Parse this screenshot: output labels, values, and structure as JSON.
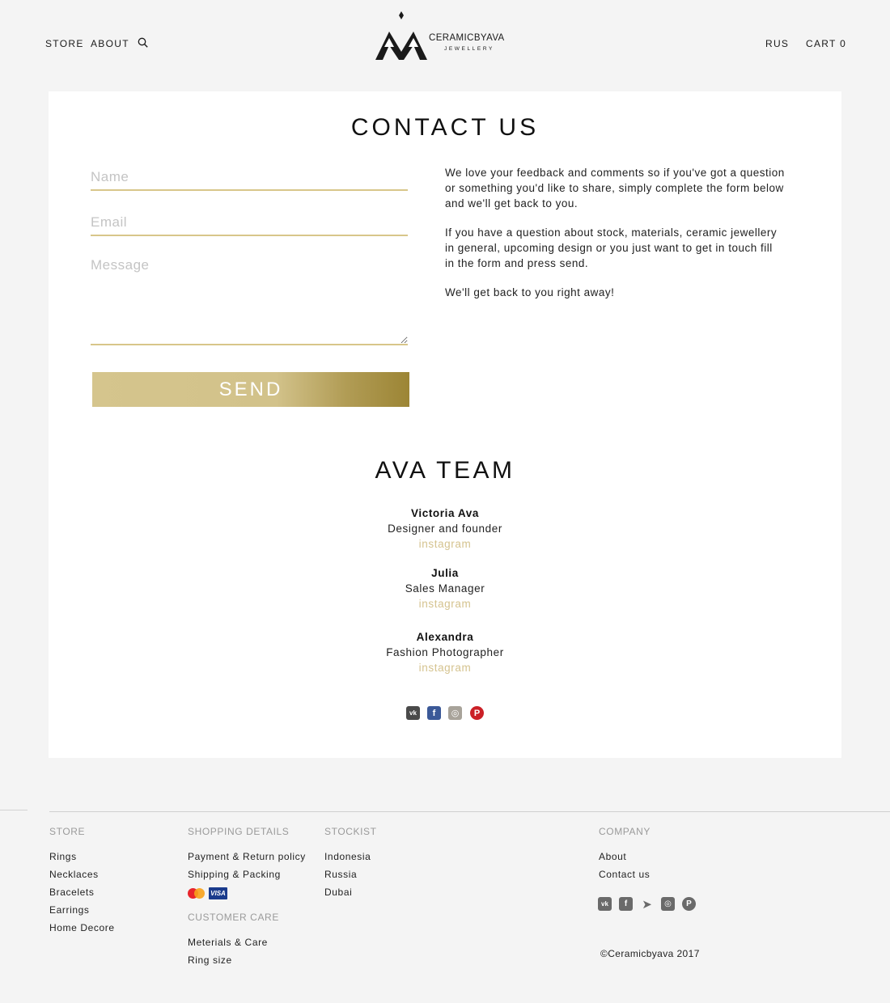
{
  "header": {
    "nav": [
      {
        "label": "STORE"
      },
      {
        "label": "ABOUT"
      }
    ],
    "logo": {
      "wordmark": "CERAMICBYAVA",
      "sub": "JEWELLERY"
    },
    "lang": "RUS",
    "cart": "CART 0"
  },
  "contact": {
    "title": "CONTACT US",
    "name_placeholder": "Name",
    "email_placeholder": "Email",
    "message_placeholder": "Message",
    "send_label": "SEND",
    "paragraphs": [
      "We love your feedback and comments so if you've got a question or something you'd like to share, simply complete the form below and we'll get back to you.",
      "If you have a question about stock, materials, ceramic jewellery in general, upcoming design or you just want to get in touch fill in the form and press send.",
      "We'll get back to you right away!"
    ]
  },
  "team": {
    "title": "AVA TEAM",
    "members": [
      {
        "name": "Victoria Ava",
        "role": "Designer and founder",
        "link": "instagram"
      },
      {
        "name": "Julia",
        "role": "Sales Manager",
        "link": "instagram"
      },
      {
        "name": "Alexandra",
        "role": "Fashion Photographer",
        "link": "instagram"
      }
    ],
    "social": [
      {
        "icon": "vk-icon",
        "glyph": "vk",
        "color": "#4a4a4a"
      },
      {
        "icon": "facebook-icon",
        "glyph": "f",
        "color": "#3b5998"
      },
      {
        "icon": "instagram-icon",
        "glyph": "◎",
        "color": "#a8a39a"
      },
      {
        "icon": "pinterest-icon",
        "glyph": "P",
        "color": "#cb2027"
      }
    ]
  },
  "footer": {
    "store": {
      "heading": "STORE",
      "links": [
        "Rings",
        "Necklaces",
        "Bracelets",
        "Earrings",
        "Home Decore"
      ]
    },
    "shopping": {
      "heading": "SHOPPING DETAILS",
      "links": [
        "Payment & Return policy",
        "Shipping & Packing"
      ],
      "payment_icons": [
        "mastercard-icon",
        "visa-icon"
      ],
      "visa_text": "VISA"
    },
    "care": {
      "heading": "CUSTOMER CARE",
      "links": [
        "Meterials & Care",
        "Ring size"
      ]
    },
    "stockist": {
      "heading": "STOCKIST",
      "links": [
        "Indonesia",
        "Russia",
        "Dubai"
      ]
    },
    "company": {
      "heading": "COMPANY",
      "links": [
        "About",
        "Contact us"
      ]
    },
    "social": [
      {
        "icon": "vk-icon",
        "glyph": "vk"
      },
      {
        "icon": "facebook-icon",
        "glyph": "f"
      },
      {
        "icon": "telegram-icon",
        "glyph": "➤"
      },
      {
        "icon": "instagram-icon",
        "glyph": "◎"
      },
      {
        "icon": "pinterest-icon",
        "glyph": "P"
      }
    ],
    "copyright": "©Ceramicbyava 2017"
  },
  "colors": {
    "accent_gold": "#d5c38f",
    "background": "#f4f4f4",
    "card": "#ffffff"
  }
}
